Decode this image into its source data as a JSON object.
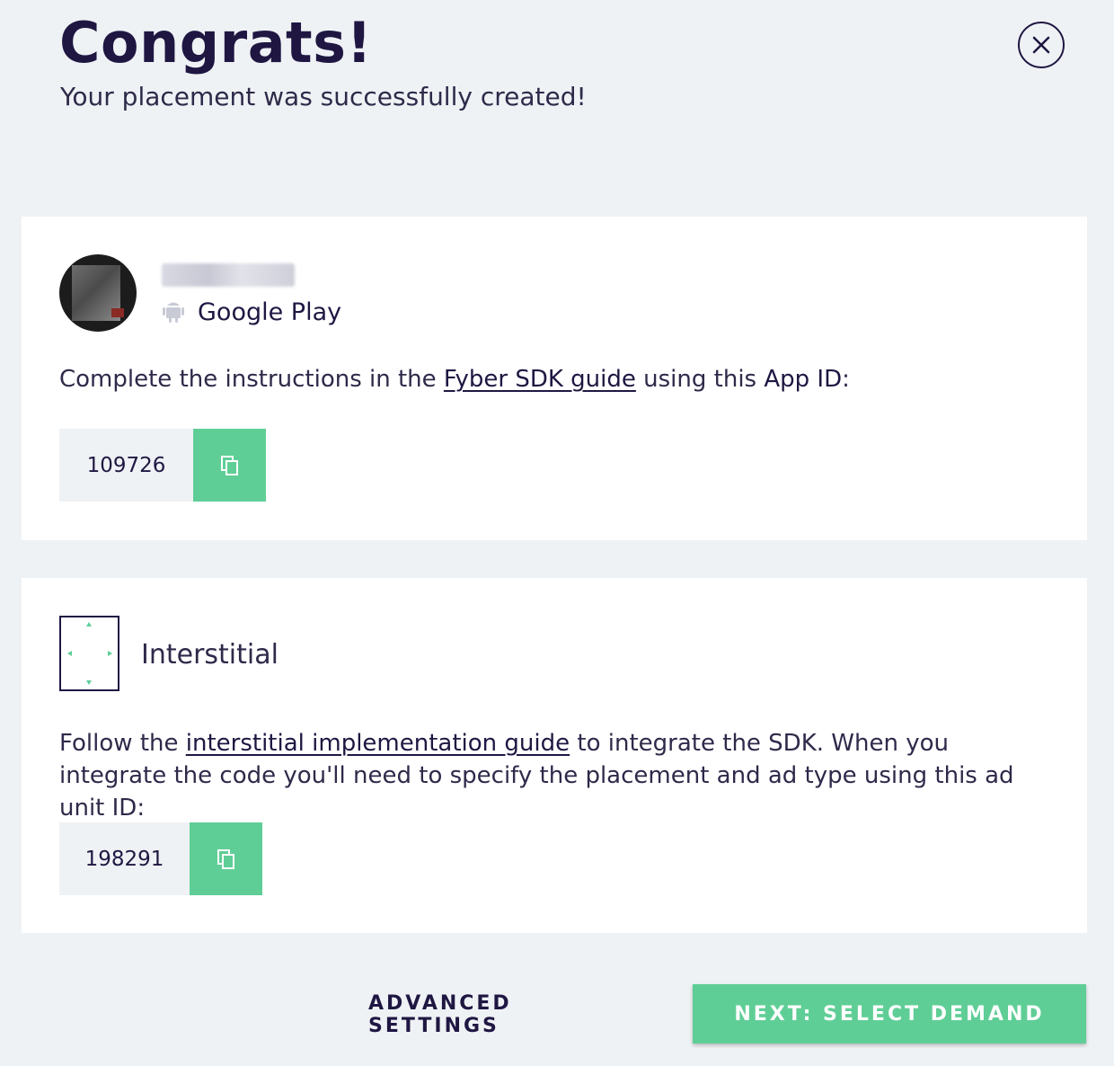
{
  "header": {
    "title": "Congrats!",
    "subtitle": "Your placement was successfully created!"
  },
  "app_card": {
    "store": "Google Play",
    "instruction": {
      "prefix": "Complete the instructions in the ",
      "link": "Fyber SDK guide",
      "middle": " using this ",
      "emphasis": "App ID",
      "suffix": ":"
    },
    "app_id": "109726",
    "icons": {
      "platform": "android-icon",
      "copy": "copy-icon"
    }
  },
  "placement_card": {
    "format": "Interstitial",
    "instruction": {
      "prefix": "Follow the ",
      "link": "interstitial implementation guide",
      "suffix": " to integrate the SDK. When you integrate the code you'll need to specify the placement and ad type using this ad unit ID:"
    },
    "ad_unit_id": "198291",
    "icons": {
      "format": "interstitial-format-icon",
      "copy": "copy-icon"
    }
  },
  "footer": {
    "advanced_settings": "ADVANCED SETTINGS",
    "next": "NEXT: SELECT DEMAND"
  },
  "colors": {
    "background": "#eff2f5",
    "text_primary": "#1f1742",
    "accent_green": "#5fce96",
    "card": "#ffffff"
  }
}
